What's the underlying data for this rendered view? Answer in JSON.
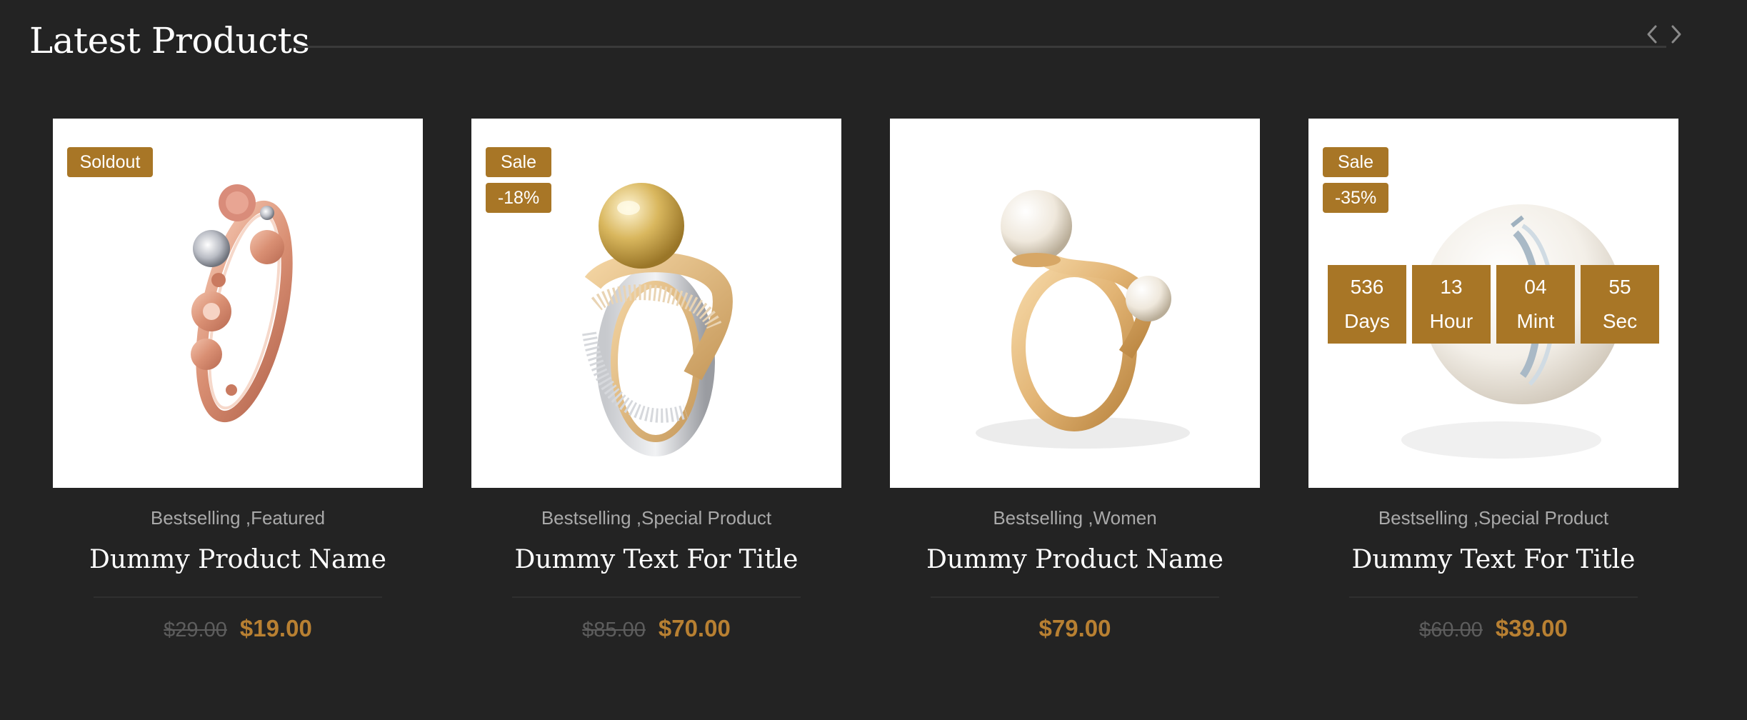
{
  "section": {
    "title": "Latest Products",
    "prev_icon": "chevron-left-icon",
    "next_icon": "chevron-right-icon"
  },
  "colors": {
    "background": "#232323",
    "accent": "#a87626",
    "price": "#b88032",
    "old_price": "#5d5d5d",
    "category_text": "#a9a9a9"
  },
  "products": [
    {
      "badges": [
        "Soldout"
      ],
      "categories": [
        "Bestselling",
        "Featured"
      ],
      "name": "Dummy Product Name",
      "old_price": "$29.00",
      "price": "$19.00",
      "image": "rose-gold-flower-ring"
    },
    {
      "badges": [
        "Sale",
        "-18%"
      ],
      "categories": [
        "Bestselling",
        "Special Product"
      ],
      "name": "Dummy Text For Title",
      "old_price": "$85.00",
      "price": "$70.00",
      "image": "golden-pearl-diamond-ring"
    },
    {
      "badges": [],
      "categories": [
        "Bestselling",
        "Women"
      ],
      "name": "Dummy Product Name",
      "old_price": "",
      "price": "$79.00",
      "image": "twin-pearl-gold-ring"
    },
    {
      "badges": [
        "Sale",
        "-35%"
      ],
      "categories": [
        "Bestselling",
        "Special Product"
      ],
      "name": "Dummy Text For Title",
      "old_price": "$60.00",
      "price": "$39.00",
      "image": "pearl-silver-ring",
      "countdown": [
        {
          "value": "536",
          "unit": "Days"
        },
        {
          "value": "13",
          "unit": "Hour"
        },
        {
          "value": "04",
          "unit": "Mint"
        },
        {
          "value": "55",
          "unit": "Sec"
        }
      ]
    }
  ]
}
